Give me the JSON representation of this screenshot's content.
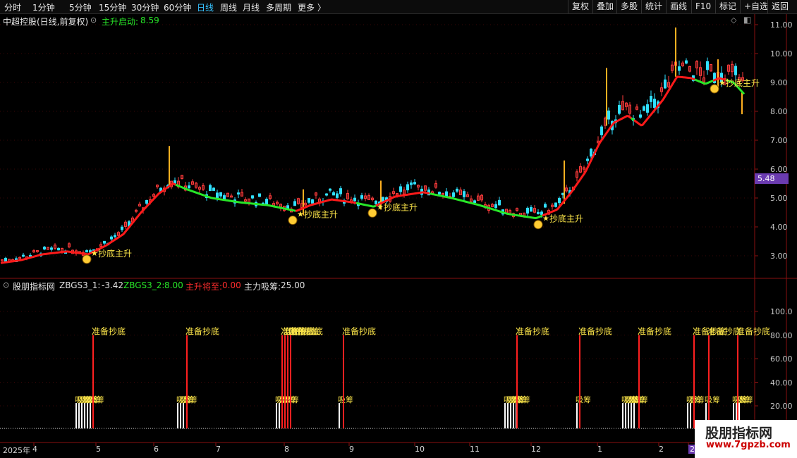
{
  "toolbar": {
    "periods": [
      "分时",
      "1分钟",
      "5分钟",
      "15分钟",
      "30分钟",
      "60分钟",
      "日线",
      "周线",
      "月线",
      "多周期",
      "更多 〉"
    ],
    "active_period": "日线",
    "right_buttons": [
      "复权",
      "叠加",
      "多股",
      "统计",
      "画线",
      "F10",
      "标记",
      "+自选",
      "返回"
    ]
  },
  "main_chart": {
    "stock_title": "中超控股(日线,前复权)",
    "indicator_name": "主升启动:",
    "indicator_value": "8.59",
    "y_ticks": [
      "11.00",
      "10.00",
      "9.00",
      "8.00",
      "7.00",
      "6.00",
      "5.00",
      "4.00",
      "3.00"
    ],
    "current_price": "5.48",
    "signal_label": "抄底主升",
    "colors": {
      "up": "#ff3b3b",
      "down": "#30e0ff",
      "line_up": "#ff1a1a",
      "line_down": "#28e628",
      "signal": "#ffe84a",
      "tag": "#6b3bb0"
    }
  },
  "sub_chart": {
    "title": "股朋指标网",
    "items": [
      {
        "label": "ZBGS3_1:",
        "value": "-3.42",
        "color": "#e0e0e0"
      },
      {
        "label": "ZBGS3_2:",
        "value": "8.00",
        "color": "#28e628"
      },
      {
        "label": "主升将至:",
        "value": "0.00",
        "color": "#ff2d2d"
      },
      {
        "label": "主力吸筹:",
        "value": "25.00",
        "color": "#e0e0e0"
      }
    ],
    "y_ticks": [
      "100.0",
      "80.00",
      "60.00",
      "40.00",
      "20.00"
    ],
    "ready_label": "准备抄底",
    "accumulate_label": "吸筹"
  },
  "x_axis": {
    "labels": [
      "2025年",
      "4",
      "5",
      "6",
      "7",
      "8",
      "9",
      "10",
      "11",
      "12",
      "1",
      "2",
      "2"
    ]
  },
  "watermark": {
    "title": "股朋指标网",
    "url": "www.7gpzb.com"
  },
  "chart_data": {
    "type": "candlestick",
    "ylim": [
      2.5,
      11.2
    ],
    "ma_line": {
      "name": "主升启动",
      "points": [
        [
          1,
          2.75
        ],
        [
          30,
          2.85
        ],
        [
          60,
          3.05
        ],
        [
          95,
          3.15
        ],
        [
          125,
          3.05
        ],
        [
          150,
          3.35
        ],
        [
          175,
          3.75
        ],
        [
          200,
          4.5
        ],
        [
          225,
          5.15
        ],
        [
          245,
          5.5
        ],
        [
          265,
          5.3
        ],
        [
          300,
          5.0
        ],
        [
          340,
          4.85
        ],
        [
          380,
          4.75
        ],
        [
          420,
          4.55
        ],
        [
          440,
          4.75
        ],
        [
          470,
          4.95
        ],
        [
          500,
          4.85
        ],
        [
          530,
          4.7
        ],
        [
          560,
          5.05
        ],
        [
          600,
          5.2
        ],
        [
          640,
          5.0
        ],
        [
          680,
          4.75
        ],
        [
          720,
          4.45
        ],
        [
          760,
          4.3
        ],
        [
          790,
          4.6
        ],
        [
          810,
          5.2
        ],
        [
          830,
          5.9
        ],
        [
          850,
          6.9
        ],
        [
          870,
          7.6
        ],
        [
          890,
          7.85
        ],
        [
          910,
          7.5
        ],
        [
          940,
          8.4
        ],
        [
          960,
          9.2
        ],
        [
          980,
          9.15
        ],
        [
          1000,
          8.95
        ],
        [
          1020,
          9.15
        ],
        [
          1040,
          9.0
        ],
        [
          1055,
          8.6
        ]
      ],
      "rising_ranges": [
        [
          0,
          250
        ],
        [
          420,
          505
        ],
        [
          535,
          610
        ],
        [
          770,
          895
        ],
        [
          900,
          985
        ],
        [
          1012,
          1030
        ]
      ]
    },
    "candles_sample": [
      {
        "x": 240,
        "high": 6.8,
        "low": 5.4
      },
      {
        "x": 430,
        "high": 5.3,
        "low": 4.4
      },
      {
        "x": 540,
        "high": 5.6,
        "low": 4.6
      },
      {
        "x": 800,
        "high": 6.3,
        "low": 4.8
      },
      {
        "x": 860,
        "high": 9.5,
        "low": 7.5
      },
      {
        "x": 958,
        "high": 10.9,
        "low": 9.2
      },
      {
        "x": 1018,
        "high": 9.8,
        "low": 8.8
      },
      {
        "x": 1052,
        "high": 8.7,
        "low": 7.9
      }
    ],
    "signals": [
      {
        "x": 135,
        "price": 3.1
      },
      {
        "x": 427,
        "price": 4.45
      },
      {
        "x": 540,
        "price": 4.7
      },
      {
        "x": 775,
        "price": 4.3
      },
      {
        "x": 1025,
        "price": 9.0
      }
    ],
    "sub_signals": {
      "ready_x": [
        132,
        265,
        400,
        404,
        408,
        412,
        487,
        733,
        822,
        906,
        984,
        1005,
        1046
      ],
      "accumulate_x": [
        108,
        112,
        116,
        120,
        124,
        128,
        252,
        256,
        260,
        392,
        396,
        400,
        404,
        481,
        716,
        720,
        724,
        728,
        732,
        818,
        883,
        887,
        891,
        895,
        899,
        975,
        979,
        1001,
        1040,
        1044,
        1048
      ]
    }
  }
}
